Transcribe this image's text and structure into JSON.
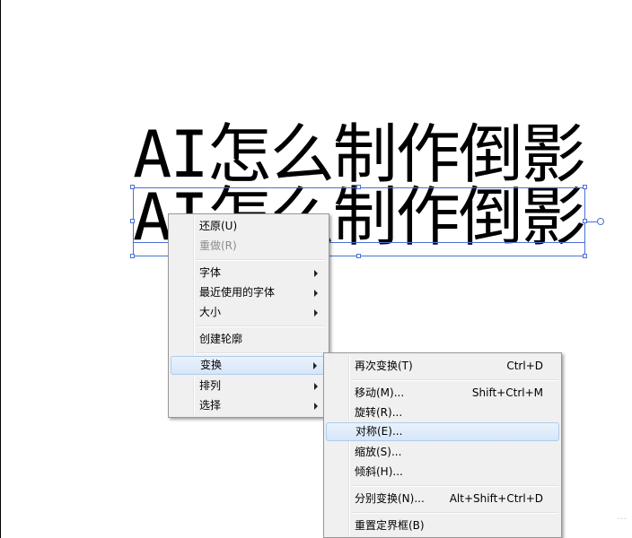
{
  "canvas": {
    "art_text_line1": "AI怎么制作倒影",
    "art_text_line2": "AI怎么制作倒影",
    "watermark": "..."
  },
  "context_menu": {
    "items": [
      {
        "label": "还原(U)",
        "enabled": true
      },
      {
        "label": "重做(R)",
        "enabled": false
      },
      {
        "label": "字体",
        "submenu": true
      },
      {
        "label": "最近使用的字体",
        "submenu": true
      },
      {
        "label": "大小",
        "submenu": true
      },
      {
        "label": "创建轮廓"
      },
      {
        "label": "变换",
        "submenu": true,
        "highlighted": true
      },
      {
        "label": "排列",
        "submenu": true
      },
      {
        "label": "选择",
        "submenu": true
      }
    ]
  },
  "transform_submenu": {
    "items": [
      {
        "label": "再次变换(T)",
        "shortcut": "Ctrl+D"
      },
      {
        "label": "移动(M)...",
        "shortcut": "Shift+Ctrl+M"
      },
      {
        "label": "旋转(R)..."
      },
      {
        "label": "对称(E)...",
        "highlighted": true
      },
      {
        "label": "缩放(S)..."
      },
      {
        "label": "倾斜(H)..."
      },
      {
        "label": "分别变换(N)...",
        "shortcut": "Alt+Shift+Ctrl+D"
      },
      {
        "label": "重置定界框(B)"
      }
    ]
  }
}
